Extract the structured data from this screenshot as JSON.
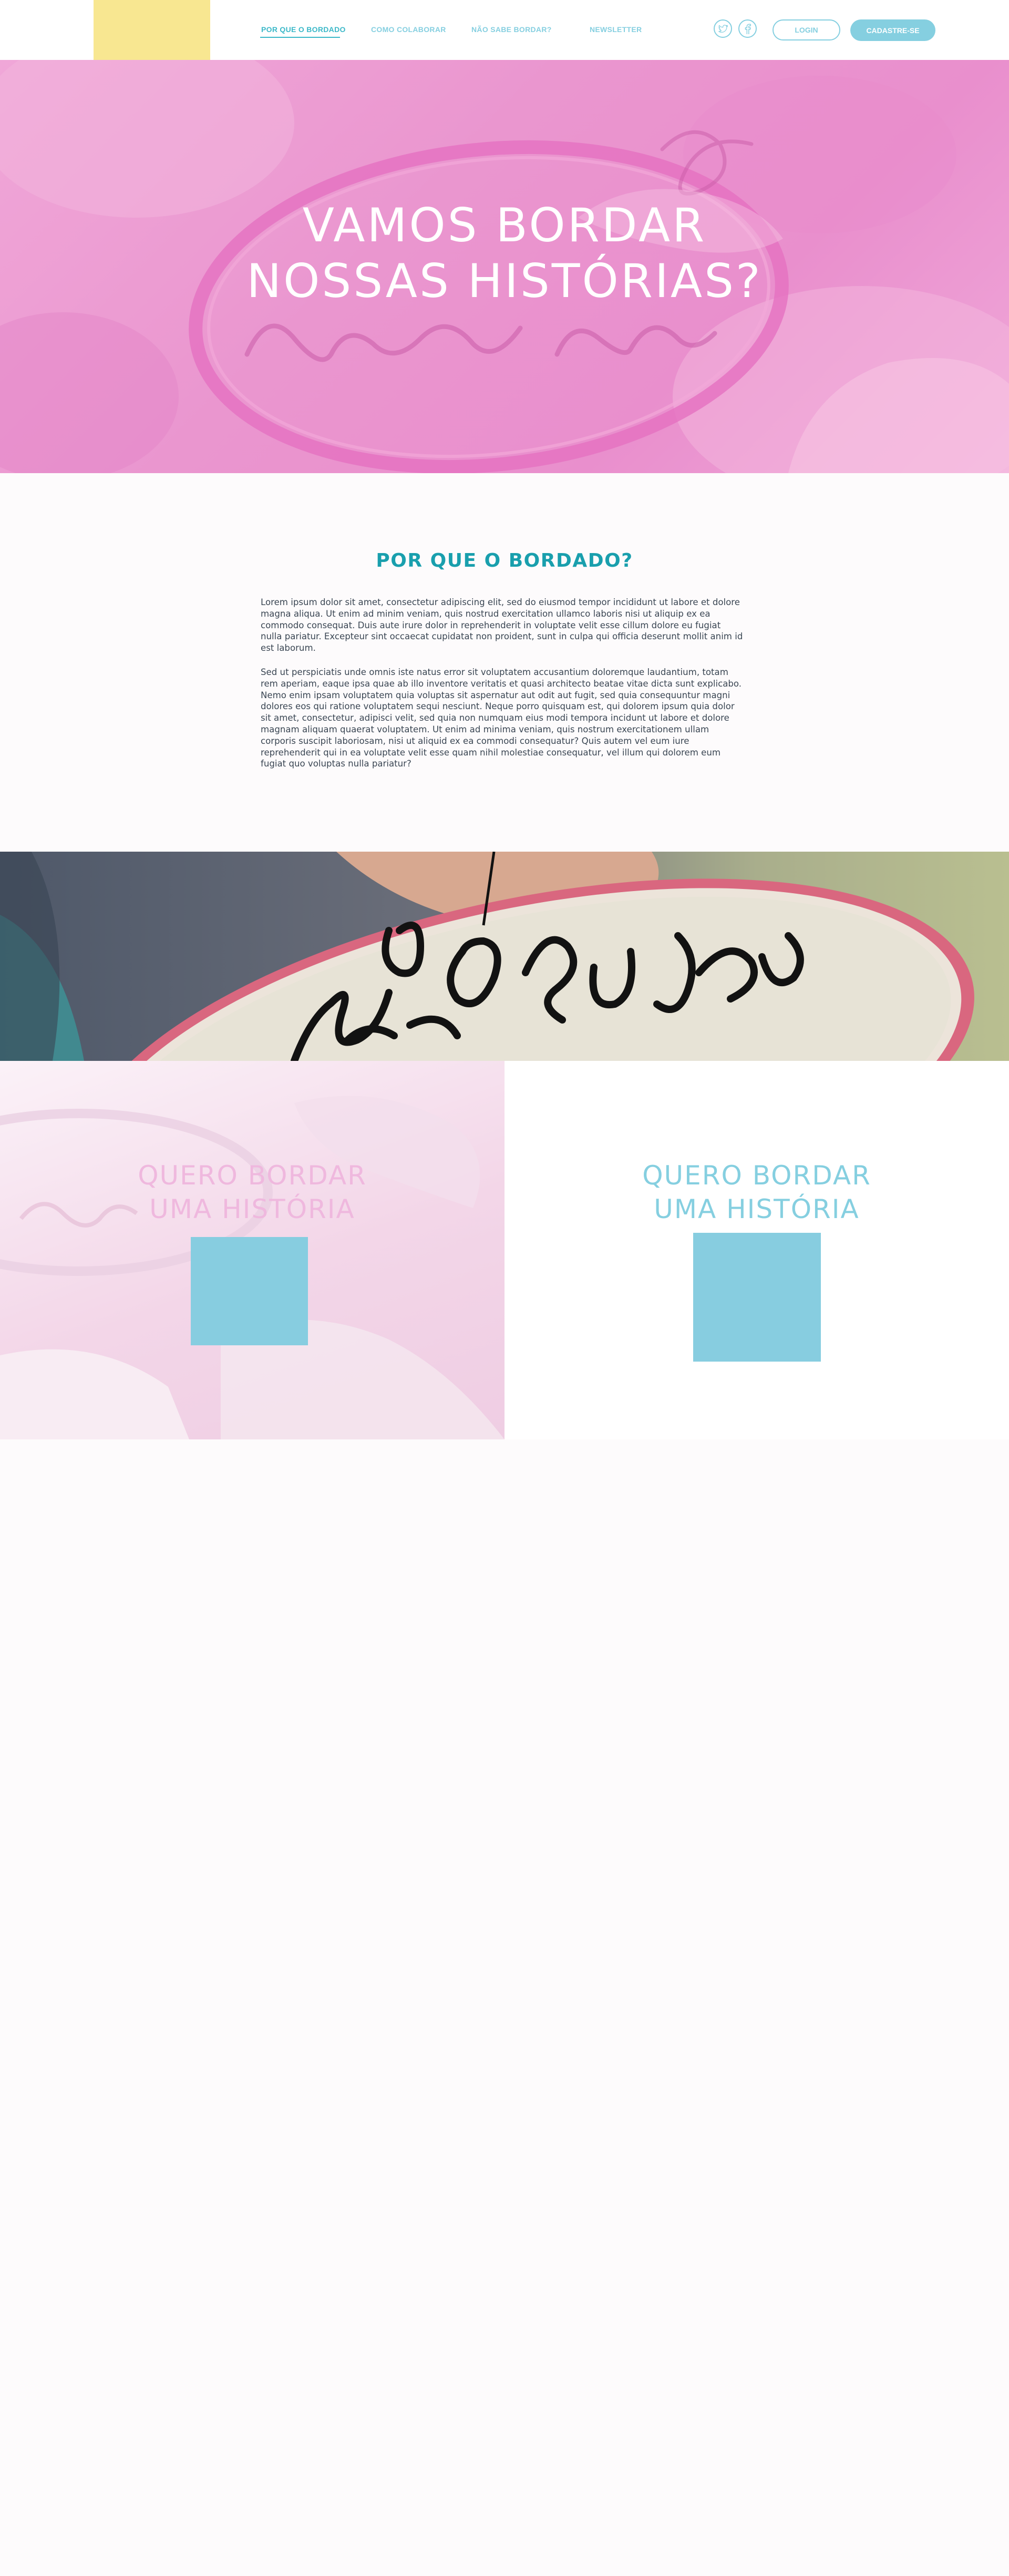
{
  "header": {
    "nav": [
      {
        "label": "POR QUE O BORDADO",
        "active": true
      },
      {
        "label": "COMO COLABORAR",
        "active": false
      },
      {
        "label": "NÃO SABE BORDAR?",
        "active": false
      },
      {
        "label": "NEWSLETTER",
        "active": false
      }
    ],
    "social": [
      "twitter-icon",
      "facebook-icon"
    ],
    "login_label": "LOGIN",
    "signup_label": "CADASTRE-SE"
  },
  "hero": {
    "title_line1": "VAMOS BORDAR",
    "title_line2": "NOSSAS HISTÓRIAS?"
  },
  "about": {
    "title": "POR QUE O BORDADO?",
    "paragraphs": [
      [
        "Lorem ipsum dolor sit amet, consectetur adipiscing elit, sed do eiusmod tempor incididunt ut labore et dolore",
        "magna aliqua. Ut enim ad minim veniam, quis nostrud exercitation ullamco laboris nisi ut aliquip ex ea",
        "commodo consequat. Duis aute irure dolor in reprehenderit in voluptate velit esse cillum dolore eu fugiat",
        "nulla pariatur. Excepteur sint occaecat cupidatat non proident, sunt in culpa qui officia deserunt mollit anim id",
        "est laborum."
      ],
      [
        "Sed ut perspiciatis unde omnis iste natus error sit voluptatem accusantium doloremque laudantium, totam",
        "rem aperiam, eaque ipsa quae ab illo inventore veritatis et quasi architecto beatae vitae dicta sunt explicabo.",
        "Nemo enim ipsam voluptatem quia voluptas sit aspernatur aut odit aut fugit, sed quia consequuntur magni",
        "dolores eos qui ratione voluptatem sequi nesciunt. Neque porro quisquam est, qui dolorem ipsum quia dolor",
        "sit amet, consectetur, adipisci velit, sed quia non numquam eius modi tempora incidunt ut labore et dolore",
        "magnam aliquam quaerat voluptatem. Ut enim ad minima veniam, quis nostrum exercitationem ullam",
        "corporis suscipit laboriosam, nisi ut aliquid ex ea commodi consequatur? Quis autem vel eum iure",
        "reprehenderit qui in ea voluptate velit esse quam nihil molestiae consequatur, vel illum qui dolorem eum",
        "fugiat quo voluptas nulla pariatur?"
      ]
    ]
  },
  "cta": [
    {
      "line1": "QUERO BORDAR",
      "line2": "UMA HISTÓRIA",
      "color": "#efb8de"
    },
    {
      "line1": "QUERO BORDAR",
      "line2": "UMA HISTÓRIA",
      "color": "#85cfe0"
    }
  ],
  "colors": {
    "accent_teal": "#199fad",
    "light_blue": "#85cfe0",
    "logo_yellow": "#f8e791",
    "hero_pink": "#ea96cf"
  }
}
